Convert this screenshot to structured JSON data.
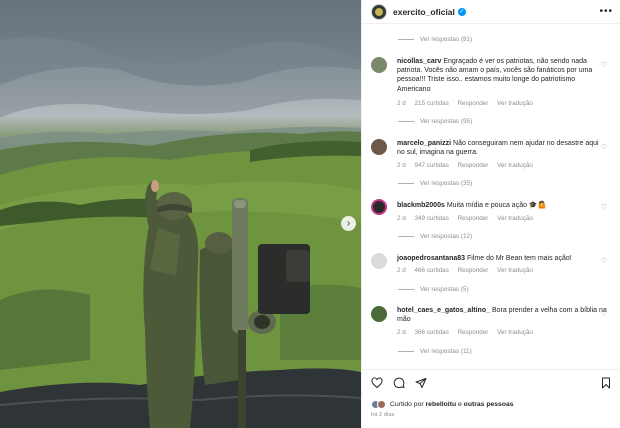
{
  "header": {
    "username": "exercito_oficial",
    "more_label": "•••"
  },
  "comments": {
    "top_replies": "Ver respostas (81)",
    "items": [
      {
        "user": "nicollas_carv",
        "text": "Engraçado é ver os patriotas, não sendo nada patriota. Vocês não amam o país, vocês são fanáticos por uma pessoa!!! Triste isso.. estamos muito longe do patriotismo Americano",
        "age": "2 d",
        "likes": "215 curtidas",
        "reply": "Responder",
        "translate": "Ver tradução",
        "replies": "Ver respostas (95)",
        "avatar_color": "#7a8a6a"
      },
      {
        "user": "marcelo_panizzi",
        "text": "Não conseguiram nem ajudar no desastre aqui no sul, imagina na guerra.",
        "age": "2 d",
        "likes": "947 curtidas",
        "reply": "Responder",
        "translate": "Ver tradução",
        "replies": "Ver respostas (35)",
        "avatar_color": "#6b5a4a"
      },
      {
        "user": "blackmb2000s",
        "text": "Muita mídia e pouca ação 🎓🤷",
        "age": "2 d",
        "likes": "349 curtidas",
        "reply": "Responder",
        "translate": "Ver tradução",
        "replies": "Ver respostas (12)",
        "avatar_color": "#2a2a2a"
      },
      {
        "user": "joaopedrosantana83",
        "text": "Filme do Mr Bean tem mais ação!",
        "age": "2 d",
        "likes": "466 curtidas",
        "reply": "Responder",
        "translate": "Ver tradução",
        "replies": "Ver respostas (5)",
        "avatar_color": "#dbdbdb"
      },
      {
        "user": "hotel_caes_e_gatos_altino_",
        "text": "Bora prender a velha com a bíblia na mão",
        "age": "2 d",
        "likes": "366 curtidas",
        "reply": "Responder",
        "translate": "Ver tradução",
        "replies": "Ver respostas (11)",
        "avatar_color": "#4a6a3a"
      }
    ]
  },
  "actions": {
    "liked_by_prefix": "Curtido por",
    "liked_by_user": "rebelloitu",
    "liked_by_and": "e",
    "liked_by_others": "outras pessoas",
    "time_ago": "há 2 dias"
  },
  "media": {
    "next_label": "›"
  }
}
